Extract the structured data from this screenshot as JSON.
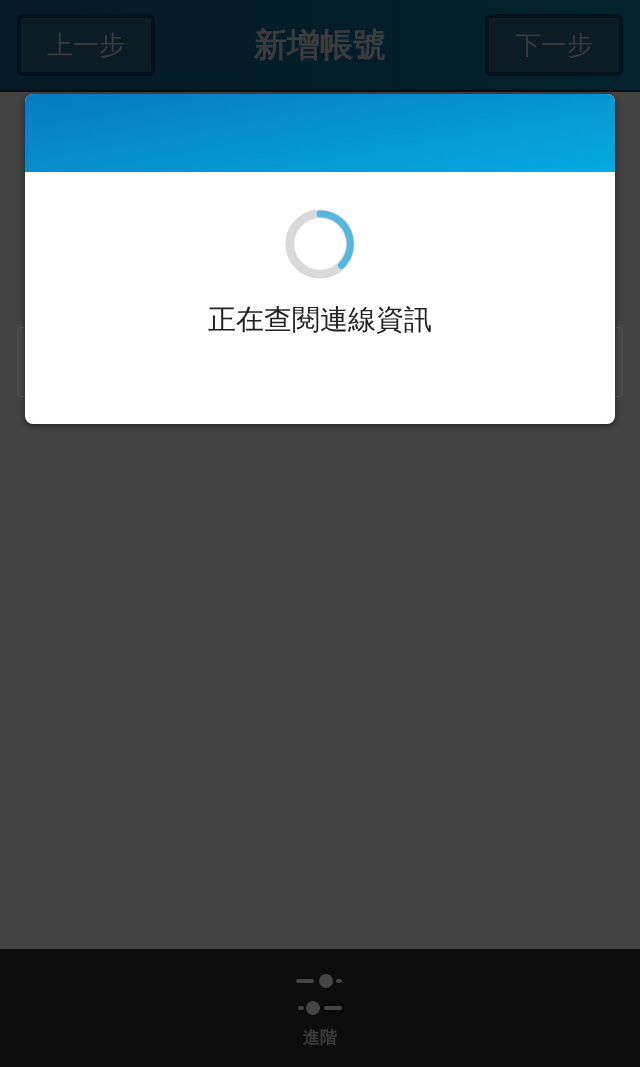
{
  "header": {
    "title": "新增帳號",
    "back_button": "上一步",
    "next_button": "下一步"
  },
  "dialog": {
    "message": "正在查閱連線資訊"
  },
  "bottom_bar": {
    "label": "進階"
  }
}
